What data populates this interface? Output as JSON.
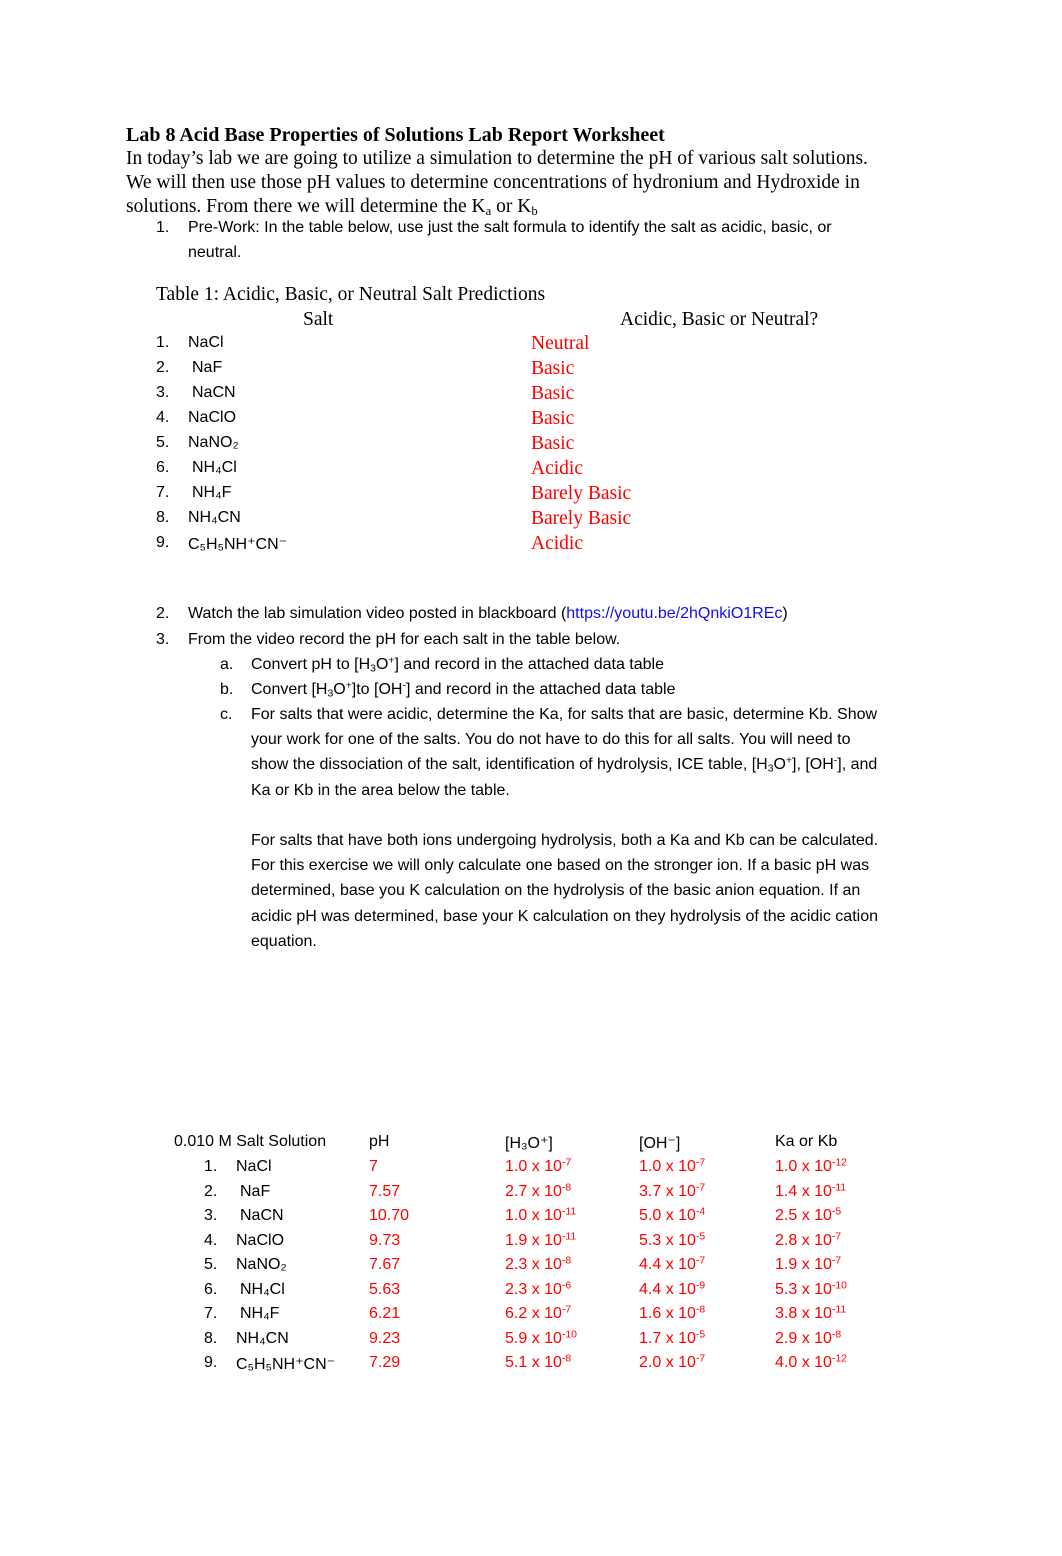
{
  "title": "Lab 8 Acid Base Properties of Solutions Lab Report Worksheet",
  "intro": {
    "line1": "In today’s lab we are going to utilize a simulation to determine the pH of various salt solutions.",
    "line2": "We will then use those pH values to determine concentrations of hydronium and Hydroxide in",
    "line3_prefix": "solutions. From there we will determine the K",
    "line3_sub_a": "a",
    "line3_or": " or K",
    "line3_sub_b": "b"
  },
  "steps": {
    "step1": {
      "number": "1.",
      "line1": "Pre-Work: In the table below, use just the salt formula to identify the salt as acidic, basic, or",
      "line2": "neutral."
    },
    "step2": {
      "number": "2.",
      "text_before": "Watch the lab simulation video posted in blackboard (",
      "link": "https://youtu.be/2hQnkiO1REc",
      "text_after": ")"
    },
    "step3": {
      "number": "3.",
      "text": "From the video record the pH for each salt in the table below.",
      "a": {
        "letter": "a.",
        "pre": "Convert pH to [H",
        "sub": "3",
        "mid": "O",
        "sup": "+",
        "post": "] and record in the attached data table"
      },
      "b": {
        "letter": "b.",
        "pre": "Convert [H",
        "sub": "3",
        "mid": "O",
        "sup": "+",
        "mid2": "]to  [OH",
        "sup2": "-",
        "post": "] and record in the attached data table"
      },
      "c": {
        "letter": "c.",
        "line1": "For salts that were acidic, determine the Ka, for salts that are basic, determine Kb. Show",
        "line2": "your work for one of the salts. You do not have to do this for all salts. You will need to",
        "line3_pre": "show the dissociation of the salt, identification of hydrolysis, ICE table, [H",
        "line3_sub": "3",
        "line3_mid": "O",
        "line3_sup": "+",
        "line3_mid2": "], [OH",
        "line3_sup2": "-",
        "line3_post": "], and",
        "line4": "Ka or Kb in the area below the table.",
        "para2": [
          "For salts that have both ions undergoing hydrolysis, both a Ka and Kb can be calculated.",
          "For this exercise we will only calculate one based on the stronger ion. If a basic pH was",
          "determined, base you K calculation on the hydrolysis of the basic anion equation. If an",
          "acidic pH was determined, base your K calculation on they hydrolysis of the acidic cation",
          "equation."
        ]
      }
    }
  },
  "table1": {
    "caption": "Table 1: Acidic, Basic, or Neutral Salt Predictions",
    "col_salt": "Salt",
    "col_answer": "Acidic, Basic or Neutral?",
    "rows": [
      {
        "num": "1.",
        "salt": "NaCl",
        "answer": "Neutral"
      },
      {
        "num": "2.",
        "salt": "NaF",
        "answer": "Basic"
      },
      {
        "num": "3.",
        "salt": "NaCN",
        "answer": "Basic"
      },
      {
        "num": "4.",
        "salt": "NaClO",
        "answer": "Basic"
      },
      {
        "num": "5.",
        "salt": "NaNO₂",
        "answer": "Basic"
      },
      {
        "num": "6.",
        "salt": "NH₄Cl",
        "answer": "Acidic"
      },
      {
        "num": "7.",
        "salt": "NH₄F",
        "answer": "Barely Basic"
      },
      {
        "num": "8.",
        "salt": "NH₄CN",
        "answer": "Barely Basic"
      },
      {
        "num": "9.",
        "salt": "C₅H₅NH⁺CN⁻",
        "answer": "Acidic"
      }
    ]
  },
  "data_table": {
    "headers": {
      "salt": "0.010 M Salt Solution",
      "ph": "pH",
      "h3o": "[H₃O⁺]",
      "oh": "[OH⁻]",
      "k": "Ka or Kb"
    },
    "rows": [
      {
        "num": "1.",
        "salt": "NaCl",
        "ph": "7",
        "h3o": [
          "1.0 x 10",
          "-7"
        ],
        "oh": [
          "1.0 x 10",
          "-7"
        ],
        "k": [
          "1.0 x 10",
          "-12"
        ]
      },
      {
        "num": "2.",
        "salt": "NaF",
        "ph": "7.57",
        "h3o": [
          "2.7 x 10",
          "-8"
        ],
        "oh": [
          "3.7 x 10",
          "-7"
        ],
        "k": [
          "1.4 x 10",
          "-11"
        ]
      },
      {
        "num": "3.",
        "salt": "NaCN",
        "ph": "10.70",
        "h3o": [
          "1.0 x 10",
          "-11"
        ],
        "oh": [
          "5.0 x 10",
          "-4"
        ],
        "k": [
          "2.5 x 10",
          "-5"
        ]
      },
      {
        "num": "4.",
        "salt": "NaClO",
        "ph": "9.73",
        "h3o": [
          "1.9 x 10",
          "-11"
        ],
        "oh": [
          "5.3 x 10",
          "-5"
        ],
        "k": [
          "2.8 x 10",
          "-7"
        ]
      },
      {
        "num": "5.",
        "salt": "NaNO₂",
        "ph": "7.67",
        "h3o": [
          "2.3 x 10",
          "-8"
        ],
        "oh": [
          "4.4 x 10",
          "-7"
        ],
        "k": [
          "1.9 x 10",
          "-7"
        ]
      },
      {
        "num": "6.",
        "salt": "NH₄Cl",
        "ph": "5.63",
        "h3o": [
          "2.3 x 10",
          "-6"
        ],
        "oh": [
          "4.4 x 10",
          "-9"
        ],
        "k": [
          "5.3 x 10",
          "-10"
        ]
      },
      {
        "num": "7.",
        "salt": "NH₄F",
        "ph": "6.21",
        "h3o": [
          "6.2 x 10",
          "-7"
        ],
        "oh": [
          "1.6 x 10",
          "-8"
        ],
        "k": [
          "3.8 x 10",
          "-11"
        ]
      },
      {
        "num": "8.",
        "salt": "NH₄CN",
        "ph": "9.23",
        "h3o": [
          "5.9 x 10",
          "-10"
        ],
        "oh": [
          "1.7 x 10",
          "-5"
        ],
        "k": [
          "2.9 x 10",
          "-8"
        ]
      },
      {
        "num": "9.",
        "salt": "C₅H₅NH⁺CN⁻",
        "ph": "7.29",
        "h3o": [
          "5.1 x 10",
          "-8"
        ],
        "oh": [
          "2.0 x 10",
          "-7"
        ],
        "k": [
          "4.0 x 10",
          "-12"
        ]
      }
    ]
  },
  "colors": {
    "answer": "#ff0000",
    "link": "#0f0fe6",
    "text": "#000000"
  }
}
